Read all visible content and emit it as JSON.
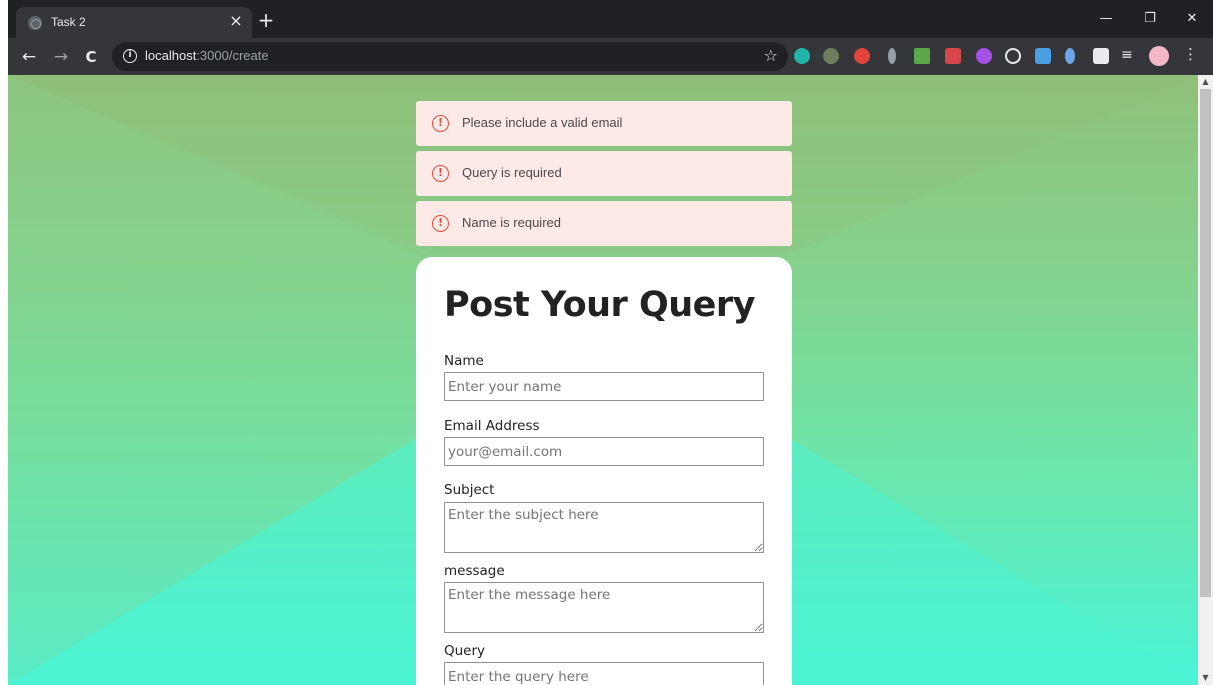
{
  "browser": {
    "tab_title": "Task 2",
    "tab_close": "×",
    "new_tab": "+",
    "url_host": "localhost",
    "url_rest": ":3000/create",
    "nav": {
      "back": "←",
      "forward": "→",
      "reload": "C"
    },
    "window": {
      "minimize": "—",
      "restore": "❐",
      "close": "✕"
    }
  },
  "alerts": [
    {
      "text": "Please include a valid email"
    },
    {
      "text": "Query is required"
    },
    {
      "text": "Name is required"
    }
  ],
  "form": {
    "title": "Post Your Query",
    "name": {
      "label": "Name",
      "placeholder": "Enter your name",
      "value": ""
    },
    "email": {
      "label": "Email Address",
      "placeholder": "your@email.com",
      "value": ""
    },
    "subject": {
      "label": "Subject",
      "placeholder": "Enter the subject here",
      "value": ""
    },
    "message": {
      "label": "message",
      "placeholder": "Enter the message here",
      "value": ""
    },
    "query": {
      "label": "Query",
      "placeholder": "Enter the query here",
      "value": ""
    }
  },
  "colors": {
    "alert_bg": "#fde9e6",
    "alert_icon": "#e04b3f",
    "bg_top": "#8fc07a",
    "bg_bottom": "#4af4d8"
  },
  "icons": [
    "globe-icon",
    "info-icon",
    "star-icon",
    "extensions-icon",
    "alert-circle-icon"
  ]
}
